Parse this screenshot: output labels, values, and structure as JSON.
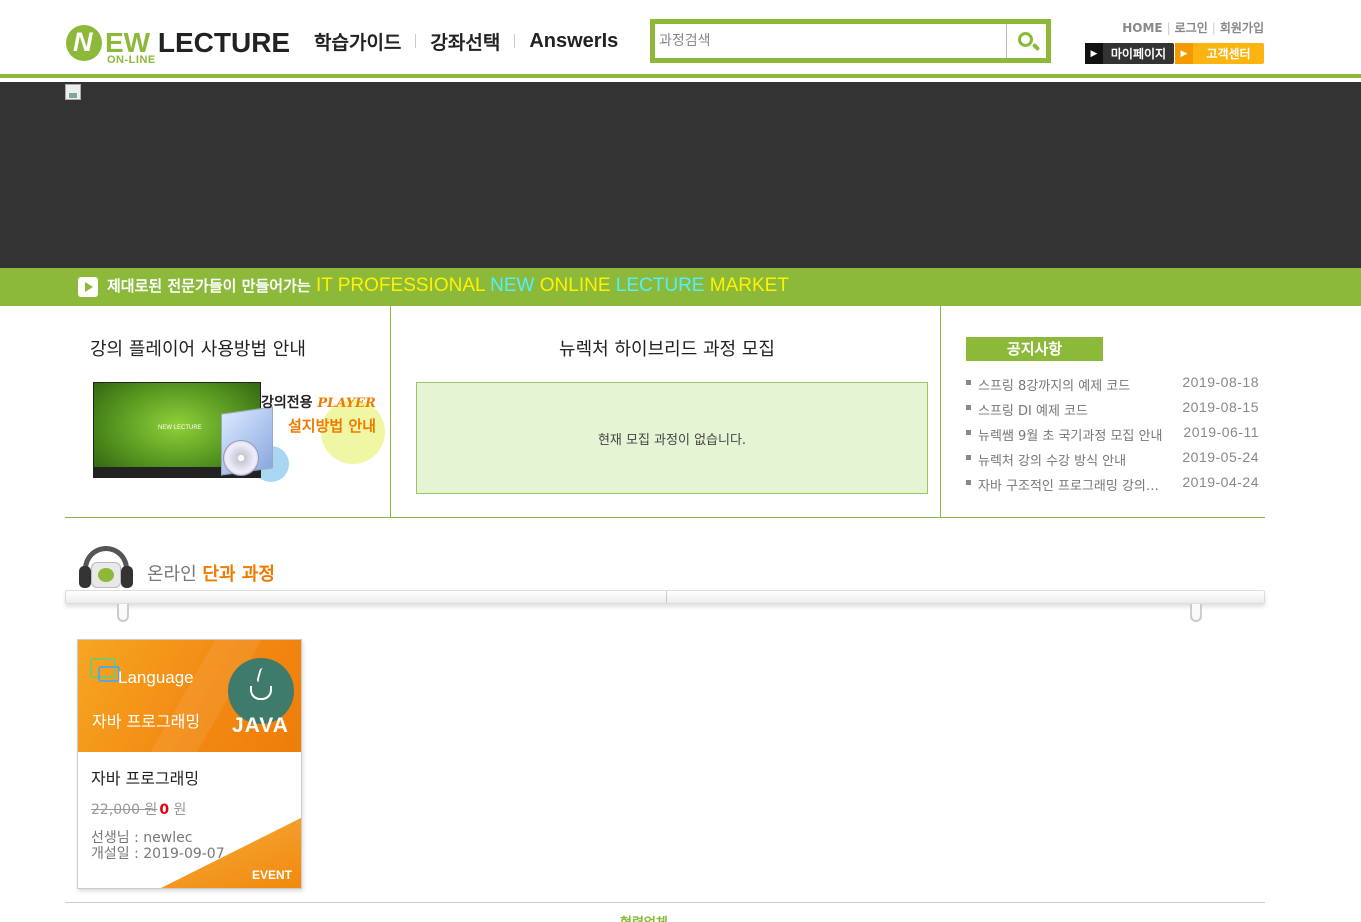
{
  "header": {
    "logo": {
      "mark": "N",
      "rest": "EW",
      "main": " LECTURE",
      "sub": "ON-LINE"
    },
    "nav": [
      "학습가이드",
      "강좌선택",
      "AnswerIs"
    ],
    "search": {
      "placeholder": "과정검색"
    },
    "util": {
      "home": "HOME",
      "login": "로그인",
      "join": "회원가입"
    },
    "mypage": "마이페이지",
    "support": "고객센터"
  },
  "slogan": {
    "ko": "제대로된 전문가들이 만들어가는",
    "w1": "IT PROFESSIONAL",
    "w2": "NEW",
    "w3": "ONLINE",
    "w4": "LECTURE",
    "w5": "MARKET"
  },
  "guide": {
    "title": "강의 플레이어 사용방법 안내",
    "img_title": "강의전용",
    "img_player": "PLAYER",
    "img_sub": "설지방법 안내",
    "mini_logo": "NEW LECTURE"
  },
  "recruit": {
    "title": "뉴렉처 하이브리드 과정 모집",
    "empty": "현재 모집 과정이 없습니다."
  },
  "notice": {
    "title": "공지사항",
    "items": [
      {
        "title": "스프링 8강까지의 예제 코드",
        "date": "2019-08-18"
      },
      {
        "title": "스프링 DI 예제 코드",
        "date": "2019-08-15"
      },
      {
        "title": "뉴렉쌤 9월 초 국기과정 모집 안내",
        "date": "2019-06-11"
      },
      {
        "title": "뉴렉처 강의 수강 방식 안내",
        "date": "2019-05-24"
      },
      {
        "title": "자바 구조적인 프로그래밍 강의 예제 파일",
        "date": "2019-04-24"
      }
    ]
  },
  "online": {
    "title_pre": "온라인 ",
    "title_hl": "단과 과정"
  },
  "course": {
    "thumb_lang": "Language",
    "thumb_ko": "자바 프로그래밍",
    "thumb_java": "JAVA",
    "title": "자바 프로그래밍",
    "old_price": "22,000 원",
    "new_price": "0",
    "unit": " 원",
    "teacher": "선생님 : newlec",
    "opened": "개설일 : 2019-09-07",
    "badge": "EVENT"
  },
  "footer": {
    "link": "협력업체"
  },
  "colors": {
    "accent": "#8cb93a",
    "orange": "#f07b00",
    "dark": "#333333"
  }
}
